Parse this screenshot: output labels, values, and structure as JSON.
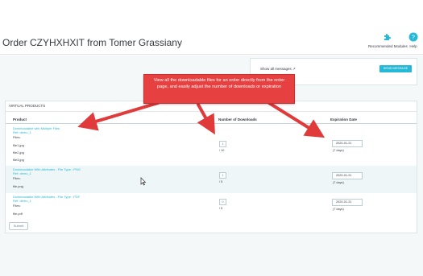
{
  "header": {
    "title": "Order CZYHXHXIT from Tomer Grassiany",
    "toolbar": [
      {
        "label": "Recommended Modules",
        "icon": "puzzle-icon"
      },
      {
        "label": "Help",
        "icon": "help-icon"
      }
    ]
  },
  "messages": {
    "show_all": "Show all messages",
    "send_button": "SEND MESSAGE"
  },
  "callout": {
    "text": "View all the downloadable files for an order directly from the order page, and easily adjust the number of downloads or expiration"
  },
  "virtual_products": {
    "title": "VIRTUAL PRODUCTS",
    "columns": {
      "product": "Product",
      "downloads": "Number of Downloads",
      "expiration": "Expiration Date"
    },
    "rows": [
      {
        "name": "Downloadable with Multiple Files",
        "ref": "Ref: demo_1",
        "files_label": "Files:",
        "files": [
          "file1.jpg",
          "file2.jpg",
          "file3.jpg"
        ],
        "downloads_value": "1",
        "downloads_max": "/ 10",
        "expiration": "2020-01-21",
        "days": "(7 days)"
      },
      {
        "name": "Downloadable With Attributes - File Type : PNG",
        "ref": "Ref: demo_1",
        "files_label": "Files:",
        "files": [
          "file.png"
        ],
        "downloads_value": "1",
        "downloads_max": "/ 5",
        "expiration": "2020-01-21",
        "days": "(7 days)"
      },
      {
        "name": "Downloadable With Attributes - File Type : PDF",
        "ref": "Ref: demo_1",
        "files_label": "Files:",
        "files": [
          "file.pdf"
        ],
        "downloads_value": "0",
        "downloads_max": "/ 5",
        "expiration": "2020-01-21",
        "days": "(7 days)"
      }
    ],
    "submit": "Submit"
  },
  "colors": {
    "accent": "#25b9d7",
    "callout": "#e74040",
    "arrow": "#e03a3a"
  }
}
